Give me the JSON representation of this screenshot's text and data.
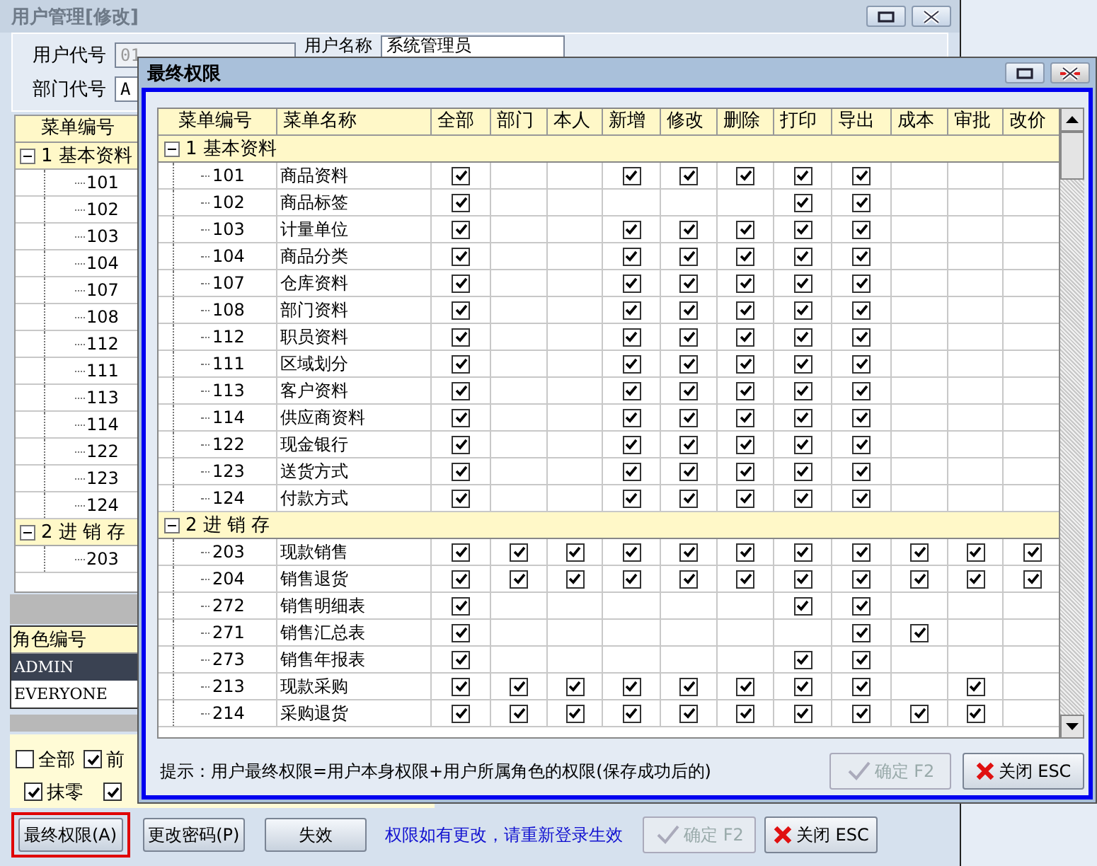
{
  "main_window": {
    "title": "用户管理[修改]",
    "fields": [
      {
        "label": "用户代号",
        "value": "01",
        "disabled": true
      },
      {
        "label": "用户名称",
        "value": "系统管理员",
        "disabled": false
      },
      {
        "label": "部门代号",
        "value": "A",
        "disabled": false
      }
    ],
    "menu_tree": {
      "column": "菜单编号",
      "groups": [
        {
          "label": "1 基本资料",
          "expanded": true,
          "children": [
            {
              "label": "101"
            },
            {
              "label": "102"
            },
            {
              "label": "103"
            },
            {
              "label": "104"
            },
            {
              "label": "107"
            },
            {
              "label": "108"
            },
            {
              "label": "112"
            },
            {
              "label": "111"
            },
            {
              "label": "113"
            },
            {
              "label": "114"
            },
            {
              "label": "122"
            },
            {
              "label": "123"
            },
            {
              "label": "124"
            }
          ]
        },
        {
          "label": "2 进 销 存",
          "expanded": true,
          "children": [
            {
              "label": "203"
            }
          ]
        }
      ]
    },
    "roles": {
      "column": "角色编号",
      "rows": [
        {
          "label": "ADMIN",
          "selected": true
        },
        {
          "label": "EVERYONE",
          "selected": false
        }
      ]
    },
    "options": [
      [
        {
          "label": "全部",
          "checked": false
        },
        {
          "label": "前",
          "checked": true
        }
      ],
      [
        {
          "label": "抹零",
          "checked": true
        },
        {
          "checked": true
        }
      ]
    ],
    "buttons": [
      {
        "label": "最终权限(A)",
        "highlighted": true
      },
      {
        "label": "更改密码(P)",
        "highlighted": false
      },
      {
        "label": "失效",
        "highlighted": false
      }
    ],
    "notice": "权限如有更改，请重新登录生效",
    "actions": [
      {
        "label": "确定 F2",
        "kind": "confirm",
        "disabled": true
      },
      {
        "label": "关闭 ESC",
        "kind": "close",
        "disabled": false
      }
    ]
  },
  "dialog": {
    "title": "最终权限",
    "columns": [
      "菜单编号",
      "菜单名称",
      "全部",
      "部门",
      "本人",
      "新增",
      "修改",
      "删除",
      "打印",
      "导出",
      "成本",
      "审批",
      "改价"
    ],
    "groups": [
      {
        "label": "1 基本资料",
        "expanded": true,
        "children": [
          {
            "code": "101",
            "name": "商品资料",
            "perms": [
              true,
              false,
              false,
              true,
              true,
              true,
              true,
              true,
              false,
              false,
              false
            ]
          },
          {
            "code": "102",
            "name": "商品标签",
            "perms": [
              true,
              false,
              false,
              false,
              false,
              false,
              true,
              true,
              false,
              false,
              false
            ]
          },
          {
            "code": "103",
            "name": "计量单位",
            "perms": [
              true,
              false,
              false,
              true,
              true,
              true,
              true,
              true,
              false,
              false,
              false
            ]
          },
          {
            "code": "104",
            "name": "商品分类",
            "perms": [
              true,
              false,
              false,
              true,
              true,
              true,
              true,
              true,
              false,
              false,
              false
            ]
          },
          {
            "code": "107",
            "name": "仓库资料",
            "perms": [
              true,
              false,
              false,
              true,
              true,
              true,
              true,
              true,
              false,
              false,
              false
            ]
          },
          {
            "code": "108",
            "name": "部门资料",
            "perms": [
              true,
              false,
              false,
              true,
              true,
              true,
              true,
              true,
              false,
              false,
              false
            ]
          },
          {
            "code": "112",
            "name": "职员资料",
            "perms": [
              true,
              false,
              false,
              true,
              true,
              true,
              true,
              true,
              false,
              false,
              false
            ]
          },
          {
            "code": "111",
            "name": "区域划分",
            "perms": [
              true,
              false,
              false,
              true,
              true,
              true,
              true,
              true,
              false,
              false,
              false
            ]
          },
          {
            "code": "113",
            "name": "客户资料",
            "perms": [
              true,
              false,
              false,
              true,
              true,
              true,
              true,
              true,
              false,
              false,
              false
            ]
          },
          {
            "code": "114",
            "name": "供应商资料",
            "perms": [
              true,
              false,
              false,
              true,
              true,
              true,
              true,
              true,
              false,
              false,
              false
            ]
          },
          {
            "code": "122",
            "name": "现金银行",
            "perms": [
              true,
              false,
              false,
              true,
              true,
              true,
              true,
              true,
              false,
              false,
              false
            ]
          },
          {
            "code": "123",
            "name": "送货方式",
            "perms": [
              true,
              false,
              false,
              true,
              true,
              true,
              true,
              true,
              false,
              false,
              false
            ]
          },
          {
            "code": "124",
            "name": "付款方式",
            "perms": [
              true,
              false,
              false,
              true,
              true,
              true,
              true,
              true,
              false,
              false,
              false
            ]
          }
        ]
      },
      {
        "label": "2 进 销 存",
        "expanded": true,
        "children": [
          {
            "code": "203",
            "name": "现款销售",
            "perms": [
              true,
              true,
              true,
              true,
              true,
              true,
              true,
              true,
              true,
              true,
              true
            ]
          },
          {
            "code": "204",
            "name": "销售退货",
            "perms": [
              true,
              true,
              true,
              true,
              true,
              true,
              true,
              true,
              true,
              true,
              true
            ]
          },
          {
            "code": "272",
            "name": "销售明细表",
            "perms": [
              true,
              false,
              false,
              false,
              false,
              false,
              true,
              true,
              false,
              false,
              false
            ]
          },
          {
            "code": "271",
            "name": "销售汇总表",
            "perms": [
              true,
              false,
              false,
              false,
              false,
              false,
              false,
              true,
              true,
              false,
              false
            ]
          },
          {
            "code": "273",
            "name": "销售年报表",
            "perms": [
              true,
              false,
              false,
              false,
              false,
              false,
              true,
              true,
              false,
              false,
              false
            ]
          },
          {
            "code": "213",
            "name": "现款采购",
            "perms": [
              true,
              true,
              true,
              true,
              true,
              true,
              true,
              true,
              false,
              true,
              false
            ]
          },
          {
            "code": "214",
            "name": "采购退货",
            "perms": [
              true,
              true,
              true,
              true,
              true,
              true,
              true,
              true,
              true,
              true,
              false
            ]
          }
        ]
      }
    ],
    "hint": "提示：用户最终权限=用户本身权限+用户所属角色的权限(保存成功后的)",
    "actions": [
      {
        "label": "确定 F2",
        "kind": "confirm",
        "disabled": true
      },
      {
        "label": "关闭 ESC",
        "kind": "close",
        "disabled": false
      }
    ]
  }
}
